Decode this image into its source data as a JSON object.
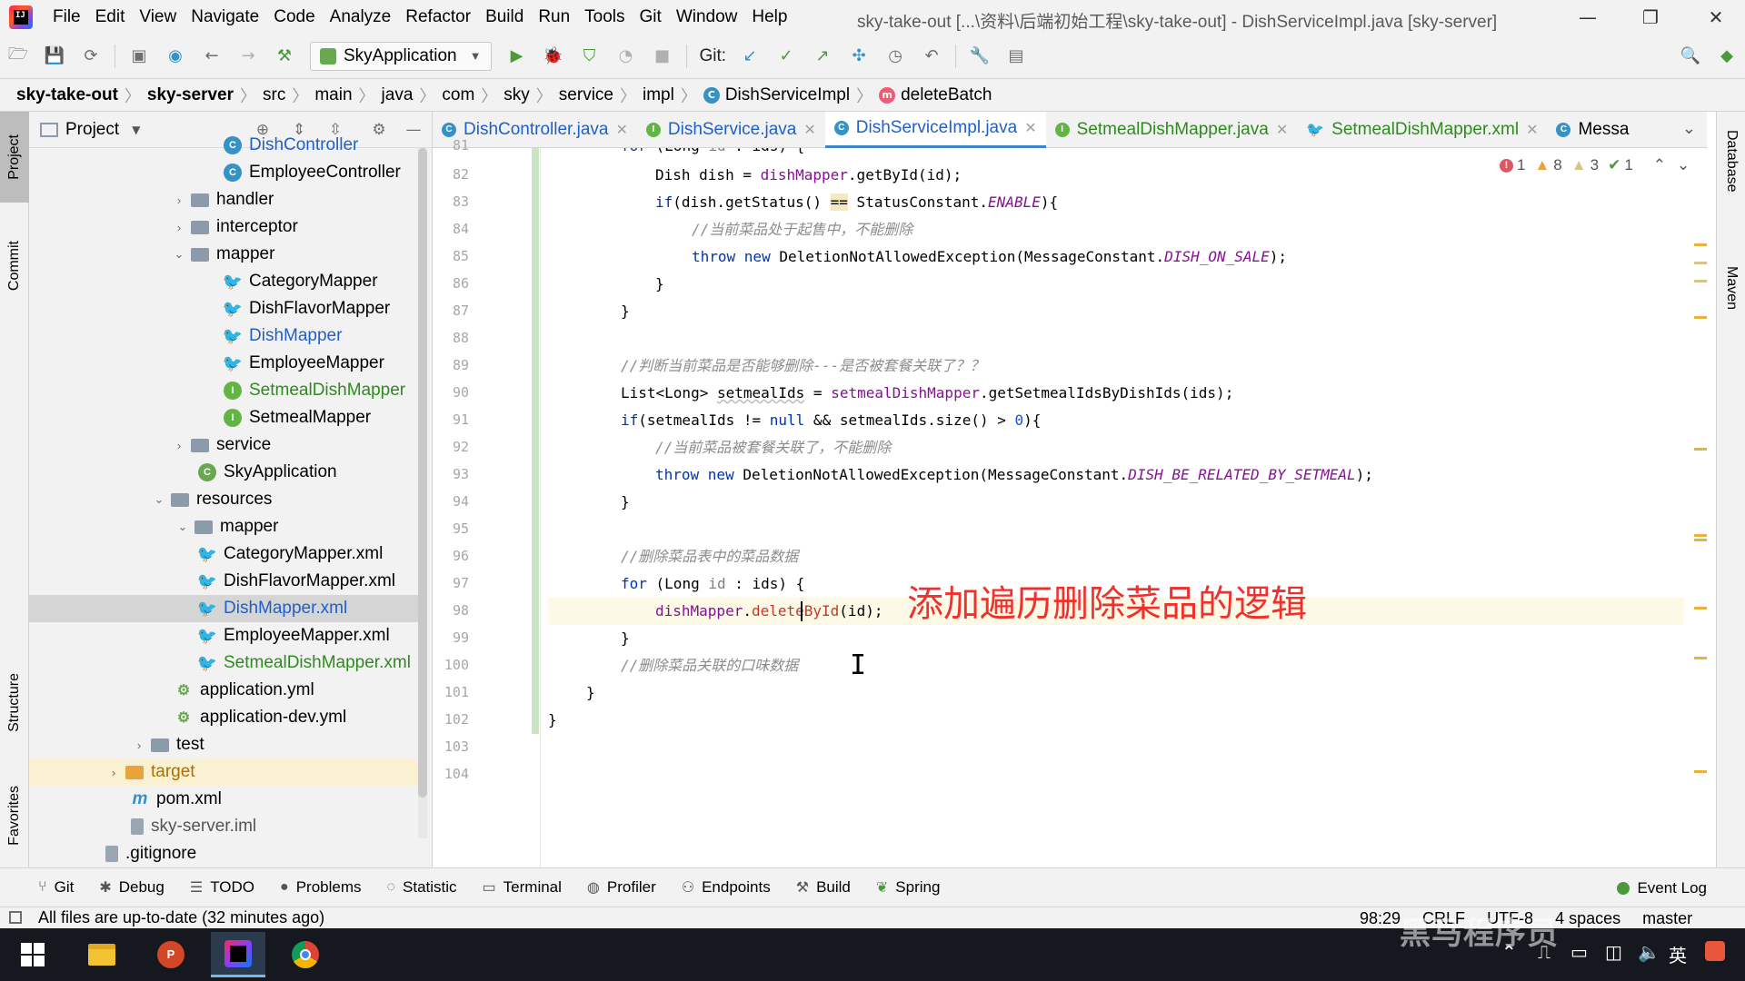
{
  "menubar": {
    "app_logo_text": "IJ",
    "items": [
      "File",
      "Edit",
      "View",
      "Navigate",
      "Code",
      "Analyze",
      "Refactor",
      "Build",
      "Run",
      "Tools",
      "Git",
      "Window",
      "Help"
    ],
    "window_title": "sky-take-out [...\\资料\\后端初始工程\\sky-take-out] - DishServiceImpl.java [sky-server]"
  },
  "toolbar": {
    "run_config": "SkyApplication",
    "git_label": "Git:"
  },
  "breadcrumb": {
    "items": [
      "sky-take-out",
      "sky-server",
      "src",
      "main",
      "java",
      "com",
      "sky",
      "service",
      "impl",
      "DishServiceImpl",
      "deleteBatch"
    ]
  },
  "left_strip": {
    "tabs": [
      "Project",
      "Commit",
      "Structure",
      "Favorites"
    ]
  },
  "project_panel": {
    "title": "Project",
    "tree": [
      {
        "label": "DishController",
        "icon": "class-icon"
      },
      {
        "label": "EmployeeController",
        "icon": "class-icon"
      },
      {
        "label": "handler",
        "icon": "folder-icon"
      },
      {
        "label": "interceptor",
        "icon": "folder-icon"
      },
      {
        "label": "mapper",
        "icon": "folder-icon"
      },
      {
        "label": "CategoryMapper",
        "icon": "mybatis-icon"
      },
      {
        "label": "DishFlavorMapper",
        "icon": "mybatis-icon"
      },
      {
        "label": "DishMapper",
        "icon": "mybatis-icon"
      },
      {
        "label": "EmployeeMapper",
        "icon": "mybatis-icon"
      },
      {
        "label": "SetmealDishMapper",
        "icon": "interface-icon"
      },
      {
        "label": "SetmealMapper",
        "icon": "interface-icon"
      },
      {
        "label": "service",
        "icon": "folder-icon"
      },
      {
        "label": "SkyApplication",
        "icon": "spring-boot-icon"
      },
      {
        "label": "resources",
        "icon": "folder-icon"
      },
      {
        "label": "mapper",
        "icon": "folder-icon"
      },
      {
        "label": "CategoryMapper.xml",
        "icon": "mybatis-icon"
      },
      {
        "label": "DishFlavorMapper.xml",
        "icon": "mybatis-icon"
      },
      {
        "label": "DishMapper.xml",
        "icon": "mybatis-icon"
      },
      {
        "label": "EmployeeMapper.xml",
        "icon": "mybatis-icon"
      },
      {
        "label": "SetmealDishMapper.xml",
        "icon": "mybatis-icon"
      },
      {
        "label": "application.yml",
        "icon": "yaml-icon"
      },
      {
        "label": "application-dev.yml",
        "icon": "yaml-icon"
      },
      {
        "label": "test",
        "icon": "folder-icon"
      },
      {
        "label": "target",
        "icon": "folder-icon"
      },
      {
        "label": "pom.xml",
        "icon": "maven-icon"
      },
      {
        "label": "sky-server.iml",
        "icon": "iml-icon"
      },
      {
        "label": ".gitignore",
        "icon": "file-icon"
      }
    ]
  },
  "editor_tabs": [
    {
      "label": "DishController.java",
      "icon": "C"
    },
    {
      "label": "DishService.java",
      "icon": "I"
    },
    {
      "label": "DishServiceImpl.java",
      "icon": "C"
    },
    {
      "label": "SetmealDishMapper.java",
      "icon": "I"
    },
    {
      "label": "SetmealDishMapper.xml",
      "icon": "mybatis"
    },
    {
      "label": "Messa",
      "icon": "C"
    }
  ],
  "inspections": {
    "errors": "1",
    "warnings": "8",
    "weak_warnings": "3",
    "ok": "1"
  },
  "editor": {
    "line_numbers": [
      "81",
      "82",
      "83",
      "84",
      "85",
      "86",
      "87",
      "88",
      "89",
      "90",
      "91",
      "92",
      "93",
      "94",
      "95",
      "96",
      "97",
      "98",
      "99",
      "100",
      "101",
      "102",
      "103",
      "104"
    ],
    "first_line_partial": "for (Long id : ids) {",
    "comments": {
      "on_sale": "//当前菜品处于起售中，不能删除",
      "related": "//判断当前菜品是否能够删除---是否被套餐关联了？？",
      "related_no_delete": "//当前菜品被套餐关联了，不能删除",
      "delete_dish": "//删除菜品表中的菜品数据",
      "delete_flavor": "//删除菜品关联的口味数据"
    },
    "annotation": "添加遍历删除菜品的逻辑"
  },
  "right_strip": {
    "tabs": [
      "Database",
      "Maven"
    ]
  },
  "bottom_tools": [
    "Git",
    "Debug",
    "TODO",
    "Problems",
    "Statistic",
    "Terminal",
    "Profiler",
    "Endpoints",
    "Build",
    "Spring"
  ],
  "event_log": "Event Log",
  "status": {
    "message": "All files are up-to-date (32 minutes ago)",
    "position": "98:29",
    "line_sep": "CRLF",
    "encoding": "UTF-8",
    "indent": "4 spaces",
    "branch": "master"
  },
  "taskbar": {
    "tray_text": "英",
    "watermark": "黑马程序员"
  }
}
